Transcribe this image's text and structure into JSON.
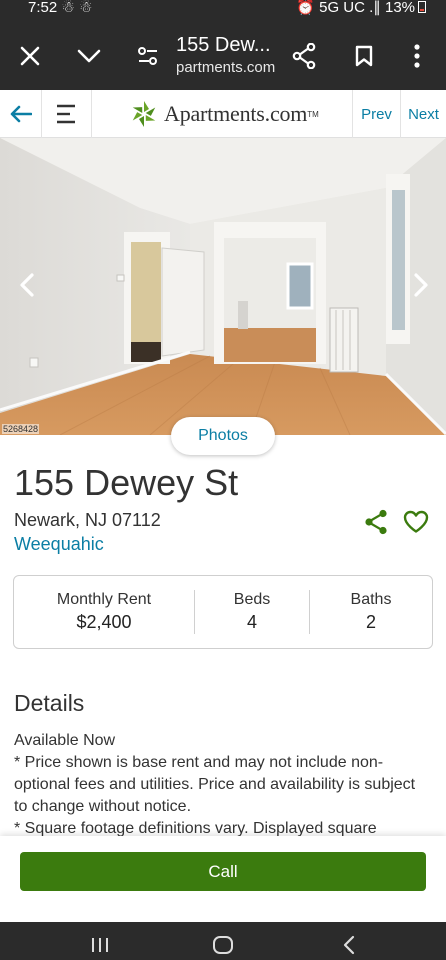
{
  "status_bar": {
    "time": "7:52 ☃ ☃",
    "right": "⏰ 5G UC .∥ 13%"
  },
  "browser": {
    "tab_title": "155 Dew...",
    "url": "partments.com"
  },
  "site_nav": {
    "logo_text": "Apartments.com",
    "logo_tm": "TM",
    "prev_label": "Prev",
    "next_label": "Next"
  },
  "gallery": {
    "mls_number": "5268428",
    "photos_button": "Photos"
  },
  "property": {
    "title": "155 Dewey St",
    "address": "Newark, NJ 07112",
    "neighborhood": "Weequahic"
  },
  "facts": {
    "rent_label": "Monthly Rent",
    "rent_value": "$2,400",
    "beds_label": "Beds",
    "beds_value": "4",
    "baths_label": "Baths",
    "baths_value": "2"
  },
  "details": {
    "heading": "Details",
    "lines": [
      "Available Now",
      "* Price shown is base rent and may not include non-optional fees and utilities. Price and availability is subject to change without notice.",
      "* Square footage definitions vary. Displayed square"
    ]
  },
  "call_button": "Call",
  "colors": {
    "brand_green": "#3b7b0e",
    "link_blue": "#0b7ea4",
    "chrome_dark": "#2b2b2b"
  },
  "icons": [
    "close-icon",
    "chevron-down-icon",
    "page-settings-icon",
    "share-icon",
    "bookmark-icon",
    "more-vert-icon",
    "back-arrow-icon",
    "hamburger-menu-icon",
    "apartments-logo-icon",
    "chevron-left-icon",
    "chevron-right-icon",
    "heart-icon",
    "recents-icon",
    "home-icon",
    "back-icon"
  ]
}
